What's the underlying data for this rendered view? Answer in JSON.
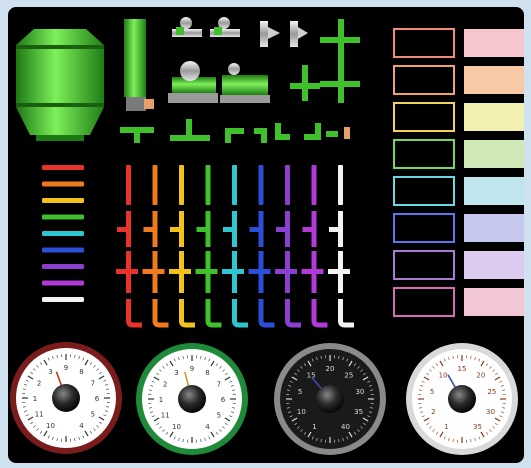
{
  "colors": {
    "background": "#000000",
    "frame": "#cfe0ee",
    "pipe_green": "#3fc12c",
    "bars": [
      "#e8332c",
      "#f07a1e",
      "#f2c21a",
      "#3fc12c",
      "#2ec7d0",
      "#2b4fd6",
      "#8a3fd0",
      "#b33ad8",
      "#f2f2f2"
    ],
    "pipe_set": [
      "#e8332c",
      "#f07a1e",
      "#f2c21a",
      "#3fc12c",
      "#2ec7d0",
      "#2b4fd6",
      "#8a3fd0",
      "#b33ad8",
      "#f2f2f2"
    ],
    "panel_borders": [
      "#f08a7a",
      "#f2a06a",
      "#f2d35e",
      "#7ad35e",
      "#6ad8e0",
      "#5a78e8",
      "#a87ad8",
      "#d86ab8"
    ],
    "swatches": [
      "#f6c6cc",
      "#f8c9a6",
      "#f3efb0",
      "#cfe9b6",
      "#bfe6ec",
      "#c6c8f0",
      "#dccbee",
      "#f2c6d6"
    ]
  },
  "icons": [
    "tank-icon",
    "column-icon",
    "valve-icon",
    "pump-icon",
    "pipe-tee-icon",
    "pipe-cross-icon",
    "pipe-elbow-icon",
    "pipe-segment-icon",
    "text-panel-icon",
    "color-swatch-icon",
    "gauge-icon"
  ],
  "gauges": [
    {
      "name": "red-rim",
      "rim": "#7a1c1c",
      "face": "#ffffff",
      "numbers": "#333333",
      "labels": [
        "10",
        "11",
        "1",
        "2",
        "3",
        "9",
        "8",
        "7",
        "6",
        "5",
        "4"
      ],
      "needle_deg": -20
    },
    {
      "name": "green-rim",
      "rim": "#1f8a3a",
      "face": "#ffffff",
      "numbers": "#333333",
      "labels": [
        "10",
        "11",
        "1",
        "2",
        "3",
        "9",
        "8",
        "7",
        "6",
        "5",
        "4"
      ],
      "needle_deg": -15
    },
    {
      "name": "dark",
      "rim": "#8a8a8a",
      "face": "#1a1a1a",
      "numbers": "#dddddd",
      "labels": [
        "1",
        "10",
        "5",
        "15",
        "20",
        "25",
        "30",
        "35",
        "40"
      ],
      "needle_deg": -40
    },
    {
      "name": "silver-rim",
      "rim": "#d9d9d9",
      "face": "#ffffff",
      "numbers": "#8a3a1a",
      "labels": [
        "1",
        "2",
        "5",
        "10",
        "15",
        "20",
        "25",
        "30",
        "35"
      ],
      "needle_deg": -30
    }
  ]
}
